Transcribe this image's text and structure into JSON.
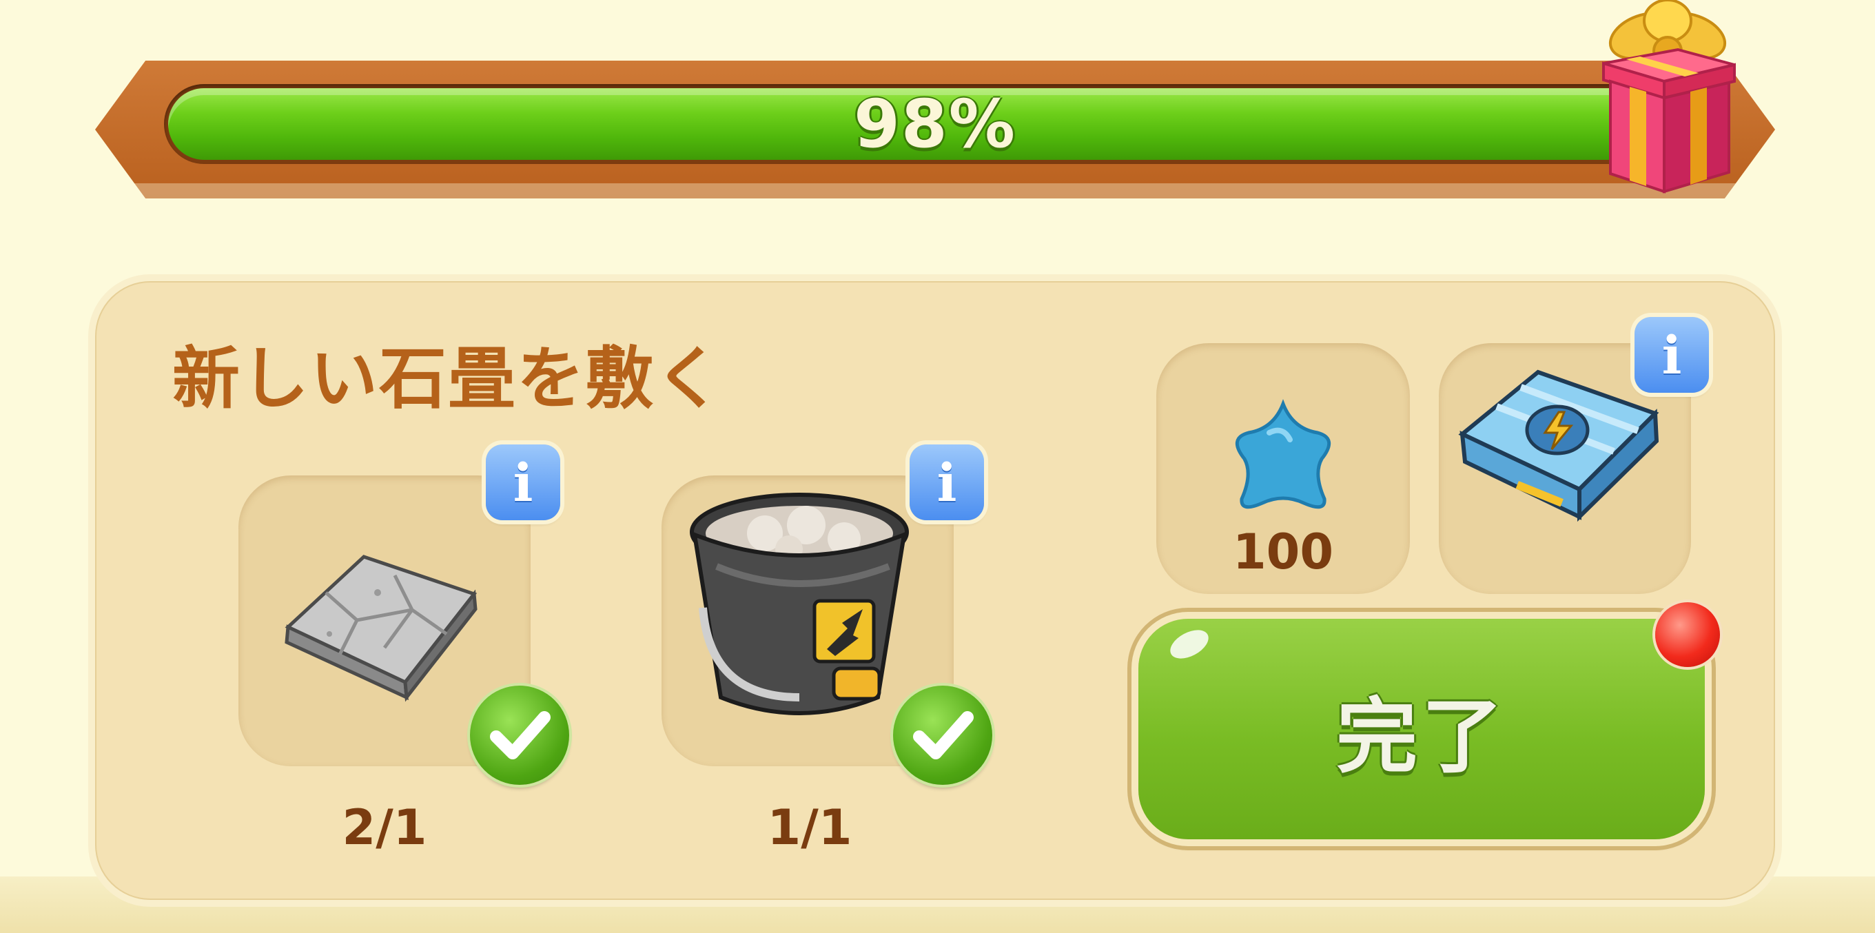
{
  "progress": {
    "percent_label": "98%",
    "value": 0.98,
    "reward_icon": "gift-box-icon"
  },
  "quest": {
    "title": "新しい石畳を敷く",
    "requirements": [
      {
        "icon": "stone-tile-icon",
        "count": "2/1",
        "completed": true
      },
      {
        "icon": "cement-bucket-icon",
        "count": "1/1",
        "completed": true
      }
    ],
    "rewards": [
      {
        "icon": "blue-star-icon",
        "amount": "100"
      },
      {
        "icon": "energy-chest-icon"
      }
    ],
    "info_label": "i",
    "complete_button": {
      "label": "完了"
    }
  },
  "colors": {
    "progress_green": "#6dcf1a",
    "frame_orange": "#c86d2a",
    "title_brown": "#b5621a",
    "button_green": "#79bc24",
    "info_blue": "#4b8ef0",
    "notify_red": "#f22a1c"
  }
}
